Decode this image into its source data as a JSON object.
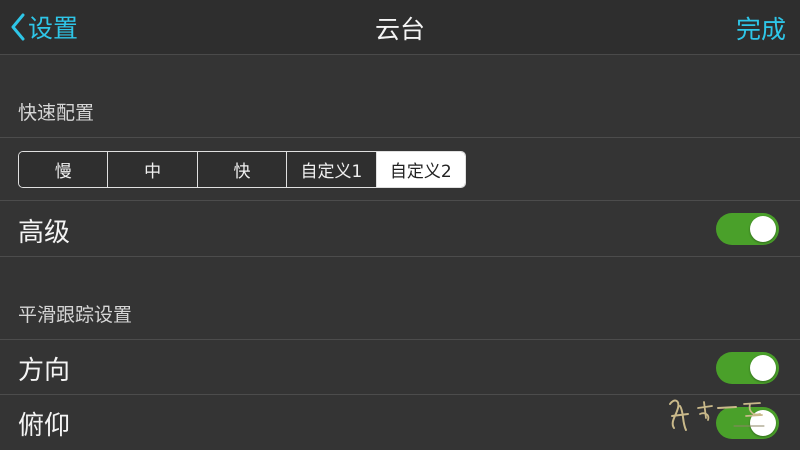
{
  "navbar": {
    "back_label": "设置",
    "title": "云台",
    "done_label": "完成",
    "accent_color": "#2ec6e8"
  },
  "quick_config": {
    "header": "快速配置",
    "segments": [
      {
        "label": "慢",
        "selected": false
      },
      {
        "label": "中",
        "selected": false
      },
      {
        "label": "快",
        "selected": false
      },
      {
        "label": "自定义1",
        "selected": false
      },
      {
        "label": "自定义2",
        "selected": true
      }
    ]
  },
  "advanced": {
    "label": "高级",
    "enabled": true
  },
  "smooth_tracking": {
    "header": "平滑跟踪设置",
    "rows": [
      {
        "label": "方向",
        "enabled": true
      },
      {
        "label": "俯仰",
        "enabled": true
      }
    ]
  },
  "toggle_color": "#4aa02a"
}
